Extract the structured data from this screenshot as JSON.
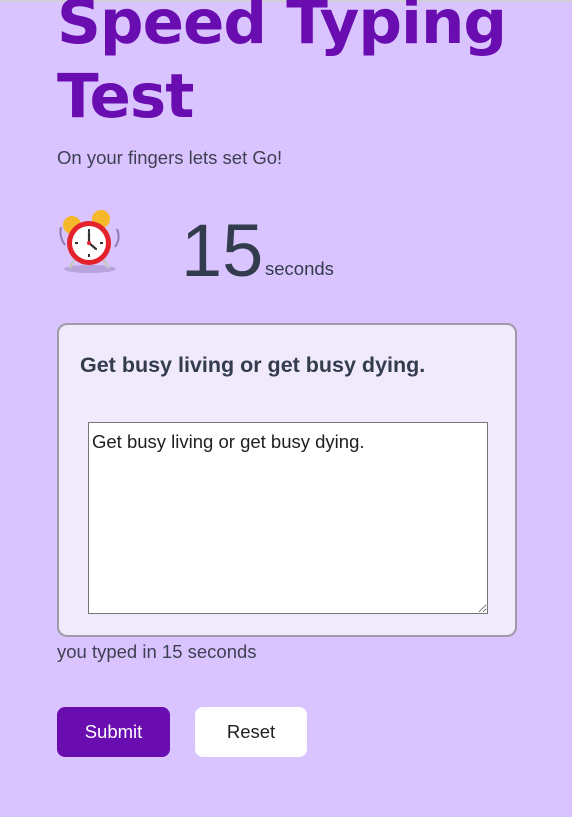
{
  "header": {
    "title": "Speed Typing Test",
    "subtitle": "On your fingers lets set Go!"
  },
  "timer": {
    "icon": "alarm-clock-icon",
    "value": "15",
    "unit": "seconds"
  },
  "typing_card": {
    "quote": "Get busy living or get busy dying.",
    "input_value": "Get busy living or get busy dying."
  },
  "result": {
    "text": "you typed in 15 seconds"
  },
  "actions": {
    "submit_label": "Submit",
    "reset_label": "Reset"
  },
  "colors": {
    "background": "#dac4ff",
    "title": "#690cb0",
    "submit_button": "#690cb0",
    "card_background": "#f1e9fc",
    "card_border": "#9d9ba6",
    "text_dark": "#323c4d"
  }
}
